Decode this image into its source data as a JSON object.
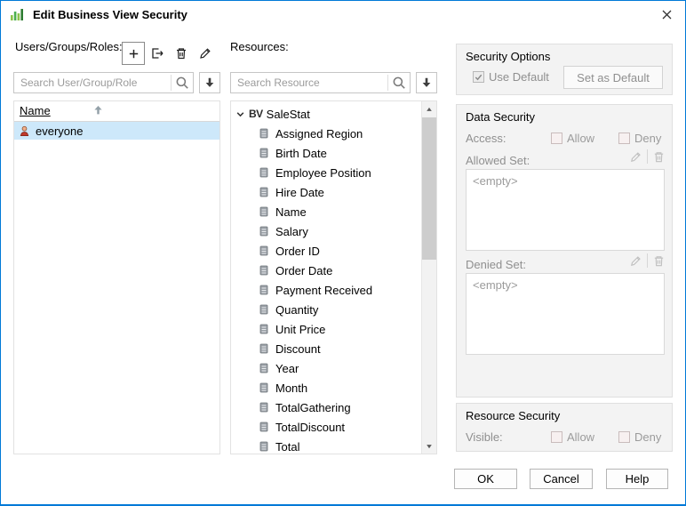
{
  "window": {
    "title": "Edit Business View Security"
  },
  "users_panel": {
    "label": "Users/Groups/Roles:",
    "search_placeholder": "Search User/Group/Role",
    "header": "Name",
    "rows": [
      {
        "name": "everyone"
      }
    ]
  },
  "resources_panel": {
    "label": "Resources:",
    "search_placeholder": "Search Resource",
    "root_icon": "BV",
    "root_label": "SaleStat",
    "items": [
      "Assigned Region",
      "Birth Date",
      "Employee Position",
      "Hire Date",
      "Name",
      "Salary",
      "Order ID",
      "Order Date",
      "Payment Received",
      "Quantity",
      "Unit Price",
      "Discount",
      "Year",
      "Month",
      "TotalGathering",
      "TotalDiscount",
      "Total"
    ]
  },
  "security_options": {
    "title": "Security Options",
    "use_default": "Use Default",
    "set_as_default": "Set as Default"
  },
  "data_security": {
    "title": "Data Security",
    "access": "Access:",
    "allow": "Allow",
    "deny": "Deny",
    "allowed_set": "Allowed Set:",
    "allowed_value": "<empty>",
    "denied_set": "Denied Set:",
    "denied_value": "<empty>"
  },
  "resource_security": {
    "title": "Resource Security",
    "visible": "Visible:",
    "allow": "Allow",
    "deny": "Deny"
  },
  "footer": {
    "ok": "OK",
    "cancel": "Cancel",
    "help": "Help"
  },
  "colors": {
    "accent": "#0079d7",
    "selection": "#cde8fa"
  }
}
